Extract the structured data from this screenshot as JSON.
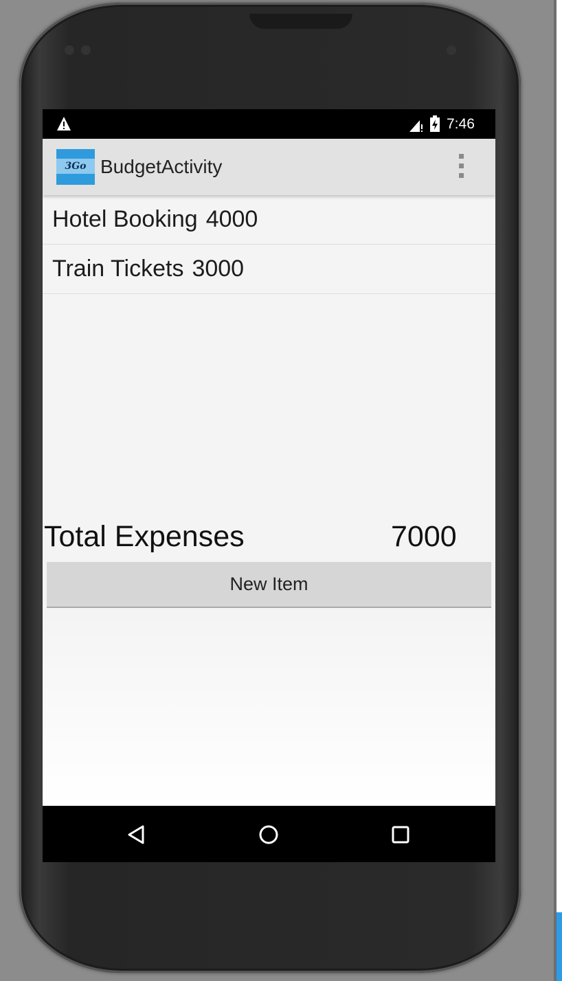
{
  "status_bar": {
    "time": "7:46",
    "icons": [
      "warning-icon",
      "signal-icon",
      "battery-icon"
    ]
  },
  "action_bar": {
    "logo_text": "3Go",
    "title": "BudgetActivity",
    "overflow_icon": "overflow-menu-icon"
  },
  "expenses": [
    {
      "name": "Hotel Booking",
      "amount": "4000"
    },
    {
      "name": "Train Tickets",
      "amount": "3000"
    }
  ],
  "total": {
    "label": "Total Expenses",
    "value": "7000"
  },
  "new_item_button": "New Item",
  "nav_bar": {
    "icons": [
      "back-icon",
      "home-icon",
      "recents-icon"
    ]
  },
  "colors": {
    "action_bar_bg": "#e2e2e2",
    "logo_blue": "#2f9bdc",
    "button_bg": "#d6d6d6"
  }
}
